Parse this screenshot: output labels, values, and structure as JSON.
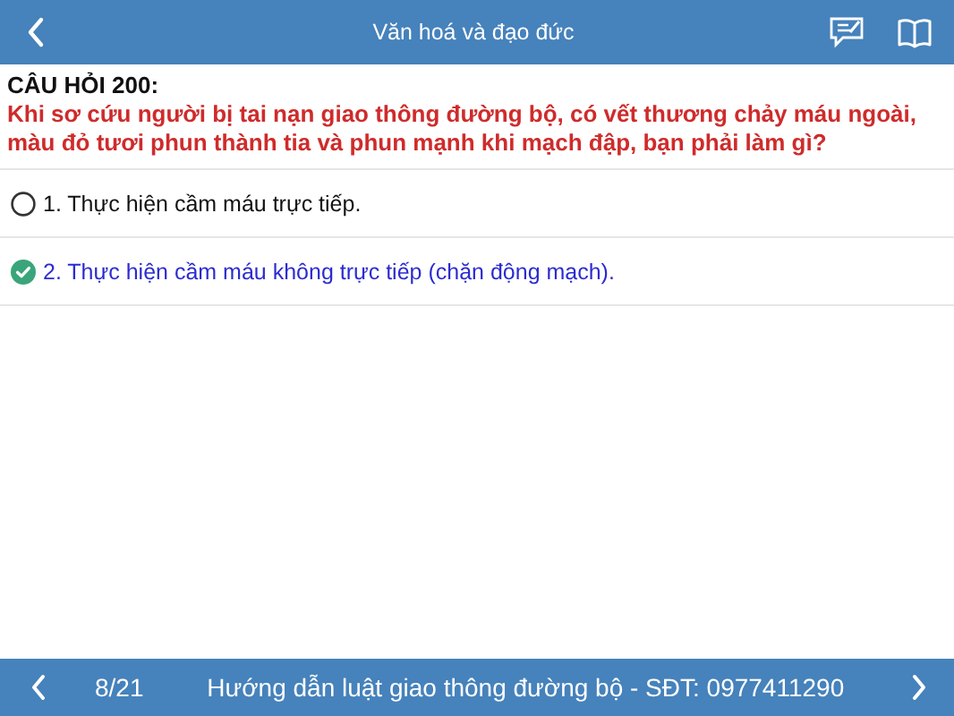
{
  "header": {
    "title": "Văn hoá và đạo đức"
  },
  "question": {
    "label": "CÂU HỎI 200:",
    "text": "Khi sơ cứu người bị tai nạn giao thông đường bộ, có vết thương chảy máu ngoài, màu đỏ tươi phun thành tia và phun mạnh khi mạch đập, bạn phải làm gì?"
  },
  "answers": [
    {
      "text": "1. Thực hiện cầm máu trực tiếp.",
      "selected": false
    },
    {
      "text": "2. Thực hiện cầm máu không trực tiếp (chặn động mạch).",
      "selected": true
    }
  ],
  "footer": {
    "page": "8/21",
    "caption": "Hướng dẫn luật giao thông đường bộ - SĐT: 0977411290"
  }
}
